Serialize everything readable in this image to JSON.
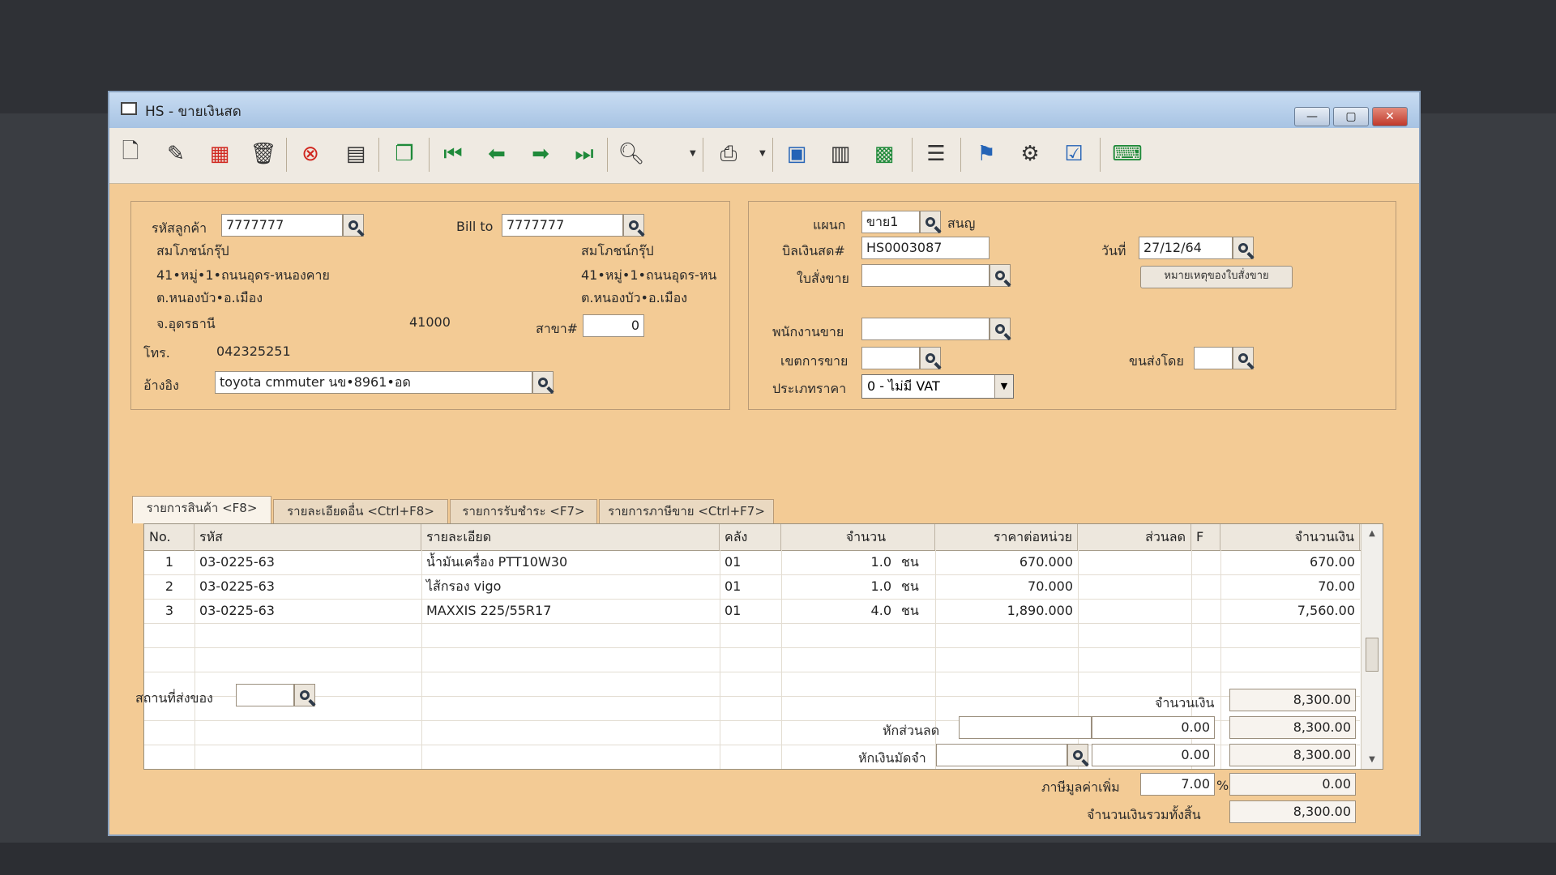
{
  "window": {
    "title": "HS - ขายเงินสด"
  },
  "customer": {
    "code_label": "รหัสลูกค้า",
    "code": "7777777",
    "billto_label": "Bill to",
    "billto": "7777777",
    "name": "สมโภชน์กรุ๊ป",
    "address1": "41•หมู่•1•ถนนอุดร-หนองคาย",
    "address2": "ต.หนองบัว•อ.เมือง",
    "address3": "จ.อุดรธานี",
    "zipcode": "41000",
    "bill_name": "สมโภชน์กรุ๊ป",
    "bill_address1": "41•หมู่•1•ถนนอุดร-หน",
    "bill_address2": "ต.หนองบัว•อ.เมือง",
    "branch_label": "สาขา#",
    "branch": "0",
    "phone_label": "โทร.",
    "phone": "042325251",
    "ref_label": "อ้างอิง",
    "ref": "toyota cmmuter นข•8961•อด"
  },
  "doc": {
    "dept_label": "แผนก",
    "dept": "ขาย1",
    "dept_name": "สนญ",
    "bill_label": "บิลเงินสด#",
    "bill_no": "HS0003087",
    "date_label": "วันที่",
    "date": "27/12/64",
    "so_label": "ใบสั่งขาย",
    "so_value": "",
    "so_note_button": "หมายเหตุของใบสั่งขาย",
    "salesman_label": "พนักงานขาย",
    "salesman": "",
    "area_label": "เขตการขาย",
    "area": "",
    "ship_by_label": "ขนส่งโดย",
    "ship_by": "",
    "price_type_label": "ประเภทราคา",
    "price_type": "0 - ไม่มี VAT"
  },
  "tabs": [
    {
      "label": "รายการสินค้า <F8>"
    },
    {
      "label": "รายละเอียดอื่น <Ctrl+F8>"
    },
    {
      "label": "รายการรับชำระ <F7>"
    },
    {
      "label": "รายการภาษีขาย <Ctrl+F7>"
    }
  ],
  "grid": {
    "headers": [
      "No.",
      "รหัส",
      "รายละเอียด",
      "คลัง",
      "จำนวน",
      "ราคาต่อหน่วย",
      "ส่วนลด",
      "F",
      "จำนวนเงิน"
    ],
    "rows": [
      {
        "no": "1",
        "code": "03-0225-63",
        "desc": "น้ำมันเครื่อง PTT10W30",
        "wh": "01",
        "qty": "1.0",
        "unit": "ชน",
        "price": "670.000",
        "disc": "",
        "f": "",
        "amount": "670.00"
      },
      {
        "no": "2",
        "code": "03-0225-63",
        "desc": "ไส้กรอง vigo",
        "wh": "01",
        "qty": "1.0",
        "unit": "ชน",
        "price": "70.000",
        "disc": "",
        "f": "",
        "amount": "70.00"
      },
      {
        "no": "3",
        "code": "03-0225-63",
        "desc": "MAXXIS 225/55R17",
        "wh": "01",
        "qty": "4.0",
        "unit": "ชน",
        "price": "1,890.000",
        "disc": "",
        "f": "",
        "amount": "7,560.00"
      }
    ]
  },
  "footer": {
    "ship_place_label": "สถานที่ส่งของ",
    "ship_place": "",
    "amount_label": "จำนวนเงิน",
    "amount": "8,300.00",
    "discount_label": "หักส่วนลด",
    "discount_text": "",
    "discount_value": "0.00",
    "after_discount": "8,300.00",
    "deposit_label": "หักเงินมัดจำ",
    "deposit_text": "",
    "deposit_value": "0.00",
    "after_deposit": "8,300.00",
    "vat_label": "ภาษีมูลค่าเพิ่ม",
    "vat_rate": "7.00",
    "vat_pct": "%",
    "vat_amount": "0.00",
    "total_label": "จำนวนเงินรวมทั้งสิ้น",
    "total": "8,300.00"
  },
  "toolbar_icons": [
    "new-doc-icon",
    "edit-icon",
    "void-icon",
    "trash-icon",
    "cancel-icon",
    "save-icon",
    "copy-icon",
    "first-record-icon",
    "previous-record-icon",
    "next-record-icon",
    "last-record-icon",
    "find-icon",
    "print-icon",
    "calculator-icon",
    "sheet-icon",
    "ok-sheet-icon",
    "report-icon",
    "approve-icon",
    "tool-icon",
    "ok-doc-icon",
    "attach-icon"
  ],
  "colors": {
    "window_bg": "#f3cb95",
    "titlebar": "#b6cfea",
    "close_btn": "#c0392b"
  }
}
